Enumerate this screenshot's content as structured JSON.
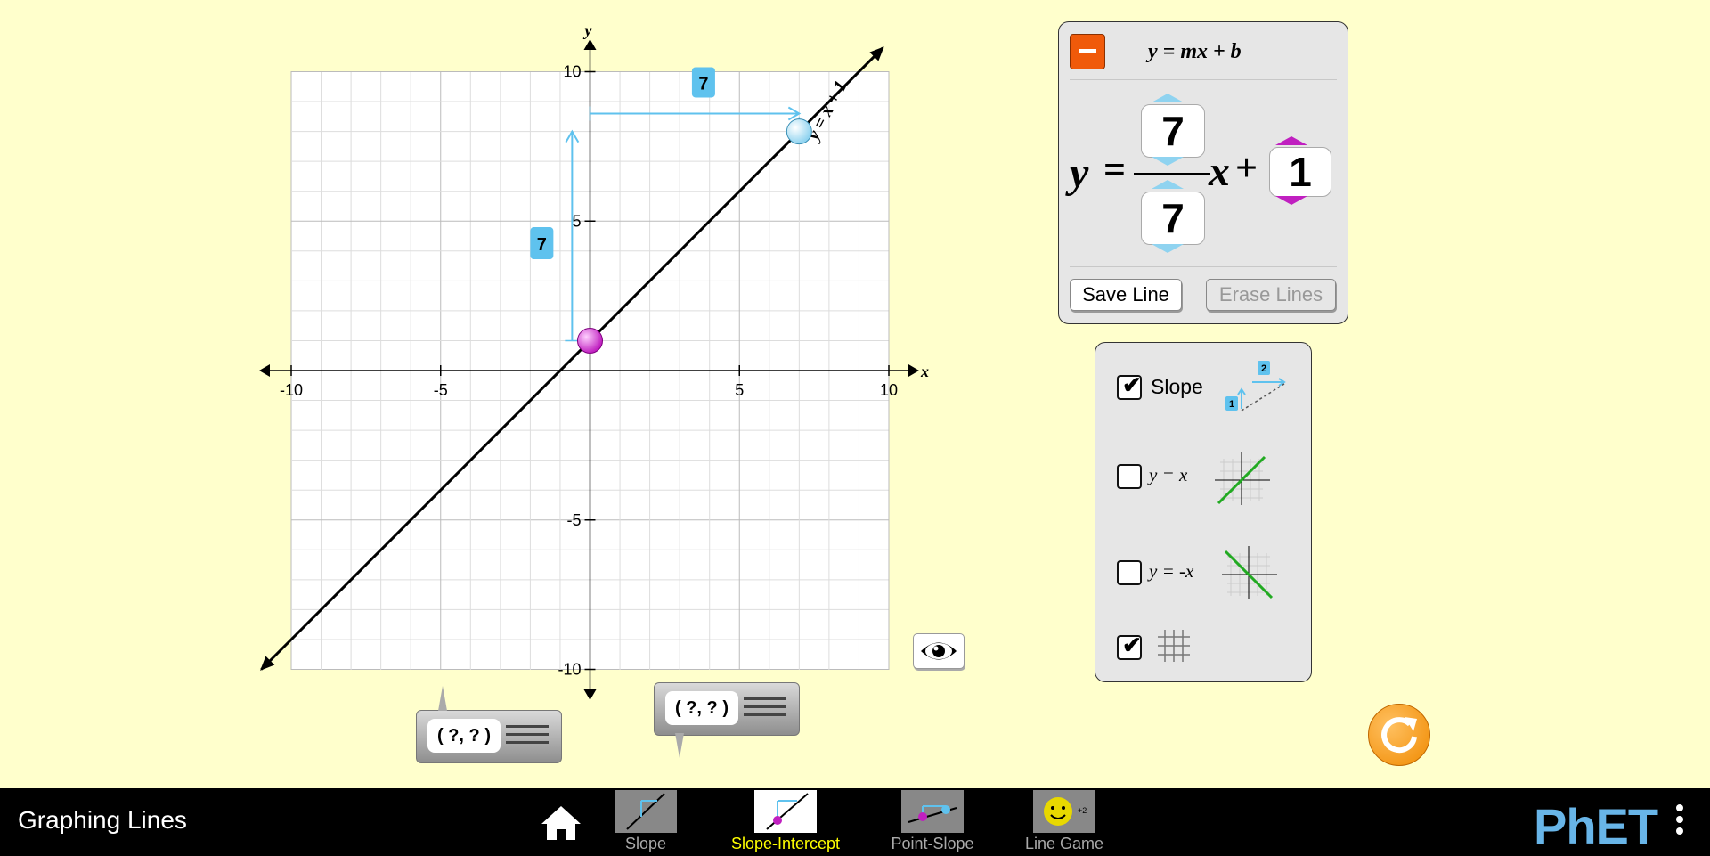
{
  "graph": {
    "x_axis_label": "x",
    "y_axis_label": "y",
    "x_tick_labels": [
      "-10",
      "-5",
      "5",
      "10"
    ],
    "y_tick_labels": [
      "10",
      "5",
      "-5",
      "-10"
    ],
    "line_label": "y = x + 1",
    "rise_label": "7",
    "run_label": "7",
    "line_color": "#000000",
    "slope_color": "#5fc2ee",
    "intercept_point_color": "#c020c0",
    "slope_point_color": "#8fd3f0"
  },
  "equation_panel": {
    "title": "y = mx + b",
    "y_symbol": "y",
    "equals": "=",
    "rise": "7",
    "run": "7",
    "x_symbol": "x",
    "plus": "+",
    "intercept": "1",
    "save_button": "Save Line",
    "erase_button": "Erase Lines"
  },
  "options_panel": {
    "slope_label": "Slope",
    "slope_checked": true,
    "slope_icon_rise": "1",
    "slope_icon_run": "2",
    "y_eq_x_label": "y = x",
    "y_eq_x_checked": false,
    "y_eq_neg_x_label": "y = -x",
    "y_eq_neg_x_checked": false,
    "grid_checked": true,
    "check_mark": "✔"
  },
  "point_tools": {
    "tool1_text": "( ?, ? )",
    "tool2_text": "( ?, ? )"
  },
  "navbar": {
    "app_title": "Graphing Lines",
    "tabs": [
      {
        "label": "Slope",
        "active": false
      },
      {
        "label": "Slope-Intercept",
        "active": true
      },
      {
        "label": "Point-Slope",
        "active": false
      },
      {
        "label": "Line Game",
        "active": false
      }
    ],
    "logo": "PhET"
  }
}
